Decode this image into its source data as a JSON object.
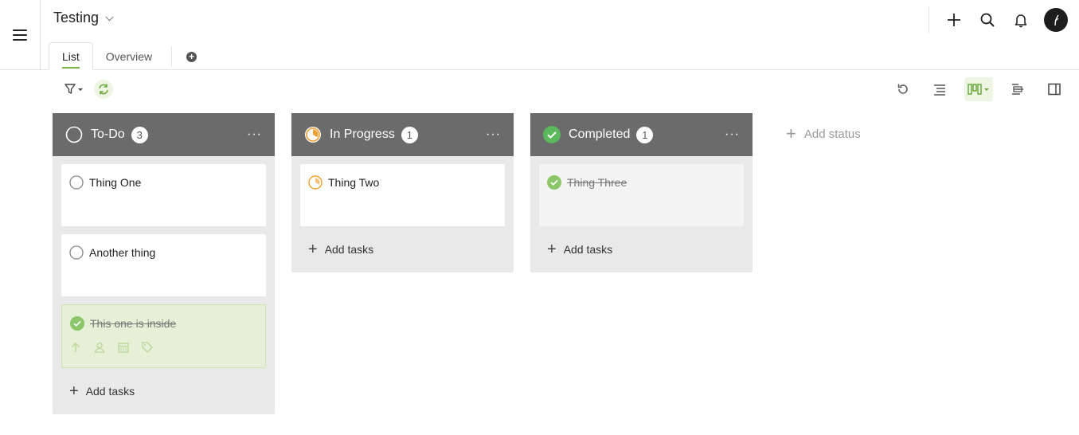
{
  "project": {
    "title": "Testing"
  },
  "tabs": [
    {
      "label": "List",
      "active": true
    },
    {
      "label": "Overview",
      "active": false
    }
  ],
  "icons": {
    "menu": "hamburger-icon",
    "add": "plus-icon",
    "search": "search-icon",
    "notifications": "bell-icon",
    "filter": "filter-icon",
    "refresh": "refresh-icon",
    "undo": "undo-icon",
    "list_view": "list-view-icon",
    "board_view": "board-view-icon",
    "gantt_view": "gantt-view-icon",
    "panel": "side-panel-icon"
  },
  "colors": {
    "accent": "#7bb241",
    "column_header": "#6b6b6b",
    "in_progress": "#f0a030",
    "completed": "#5cb85c"
  },
  "columns": [
    {
      "name": "To-Do",
      "count": "3",
      "status": "todo",
      "cards": [
        {
          "title": "Thing One",
          "status": "todo"
        },
        {
          "title": "Another thing",
          "status": "todo"
        },
        {
          "title": "This one is inside",
          "status": "done"
        }
      ],
      "add_label": "Add tasks"
    },
    {
      "name": "In Progress",
      "count": "1",
      "status": "progress",
      "cards": [
        {
          "title": "Thing Two",
          "status": "progress"
        }
      ],
      "add_label": "Add tasks"
    },
    {
      "name": "Completed",
      "count": "1",
      "status": "done",
      "cards": [
        {
          "title": "Thing Three",
          "status": "done"
        }
      ],
      "add_label": "Add tasks"
    }
  ],
  "add_status_label": "Add status"
}
